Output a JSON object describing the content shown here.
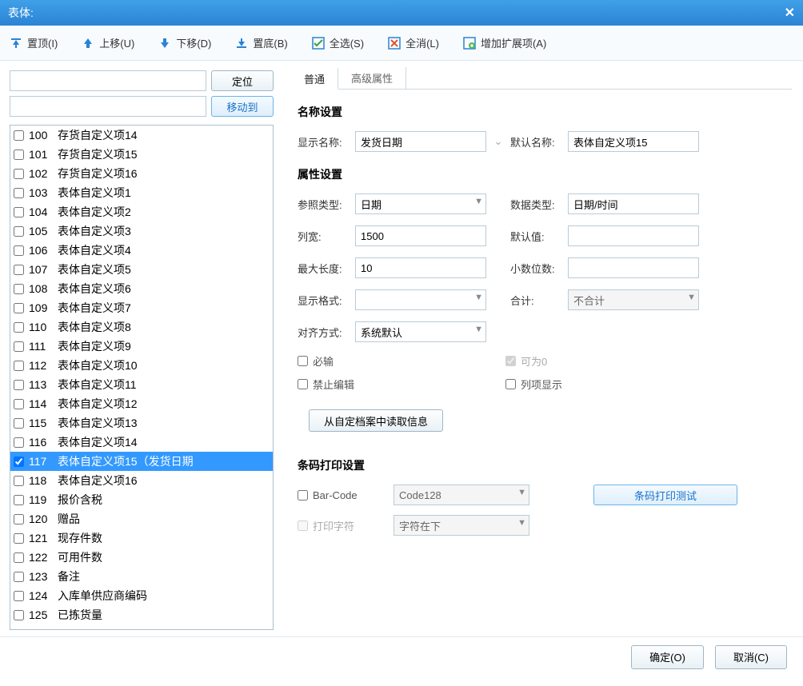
{
  "titlebar": {
    "title": "表体:"
  },
  "toolbar": {
    "top": "置顶(I)",
    "up": "上移(U)",
    "down": "下移(D)",
    "bottom": "置底(B)",
    "selectAll": "全选(S)",
    "clearAll": "全消(L)",
    "addExt": "增加扩展项(A)"
  },
  "left": {
    "locate": "定位",
    "moveTo": "移动到"
  },
  "list": [
    {
      "n": "100",
      "t": "存货自定义项14",
      "c": false
    },
    {
      "n": "101",
      "t": "存货自定义项15",
      "c": false
    },
    {
      "n": "102",
      "t": "存货自定义项16",
      "c": false
    },
    {
      "n": "103",
      "t": "表体自定义项1",
      "c": false
    },
    {
      "n": "104",
      "t": "表体自定义项2",
      "c": false
    },
    {
      "n": "105",
      "t": "表体自定义项3",
      "c": false
    },
    {
      "n": "106",
      "t": "表体自定义项4",
      "c": false
    },
    {
      "n": "107",
      "t": "表体自定义项5",
      "c": false
    },
    {
      "n": "108",
      "t": "表体自定义项6",
      "c": false
    },
    {
      "n": "109",
      "t": "表体自定义项7",
      "c": false
    },
    {
      "n": "110",
      "t": "表体自定义项8",
      "c": false
    },
    {
      "n": "111",
      "t": "表体自定义项9",
      "c": false
    },
    {
      "n": "112",
      "t": "表体自定义项10",
      "c": false
    },
    {
      "n": "113",
      "t": "表体自定义项11",
      "c": false
    },
    {
      "n": "114",
      "t": "表体自定义项12",
      "c": false
    },
    {
      "n": "115",
      "t": "表体自定义项13",
      "c": false
    },
    {
      "n": "116",
      "t": "表体自定义项14",
      "c": false
    },
    {
      "n": "117",
      "t": "表体自定义项15（发货日期",
      "c": true,
      "sel": true
    },
    {
      "n": "118",
      "t": "表体自定义项16",
      "c": false
    },
    {
      "n": "119",
      "t": "报价含税",
      "c": false
    },
    {
      "n": "120",
      "t": "赠品",
      "c": false
    },
    {
      "n": "121",
      "t": "现存件数",
      "c": false
    },
    {
      "n": "122",
      "t": "可用件数",
      "c": false
    },
    {
      "n": "123",
      "t": "备注",
      "c": false
    },
    {
      "n": "124",
      "t": "入库单供应商编码",
      "c": false
    },
    {
      "n": "125",
      "t": "已拣货量",
      "c": false
    }
  ],
  "tabs": {
    "general": "普通",
    "advanced": "高级属性"
  },
  "sections": {
    "name": "名称设置",
    "attr": "属性设置",
    "barcode": "条码打印设置"
  },
  "labels": {
    "displayName": "显示名称:",
    "defaultName": "默认名称:",
    "refType": "参照类型:",
    "dataType": "数据类型:",
    "colWidth": "列宽:",
    "defaultVal": "默认值:",
    "maxLen": "最大长度:",
    "decimal": "小数位数:",
    "format": "显示格式:",
    "sum": "合计:",
    "align": "对齐方式:",
    "required": "必输",
    "allowZero": "可为0",
    "noEdit": "禁止编辑",
    "colShow": "列项显示",
    "loadFromFile": "从自定档案中读取信息",
    "barcode": "Bar-Code",
    "printChar": "打印字符",
    "barcodeTest": "条码打印测试"
  },
  "values": {
    "displayName": "发货日期",
    "defaultName": "表体自定义项15",
    "refType": "日期",
    "dataType": "日期/时间",
    "colWidth": "1500",
    "defaultVal": "",
    "maxLen": "10",
    "decimal": "",
    "format": "",
    "sum": "不合计",
    "align": "系统默认",
    "barcodeType": "Code128",
    "printCharPos": "字符在下"
  },
  "footer": {
    "ok": "确定(O)",
    "cancel": "取消(C)"
  }
}
